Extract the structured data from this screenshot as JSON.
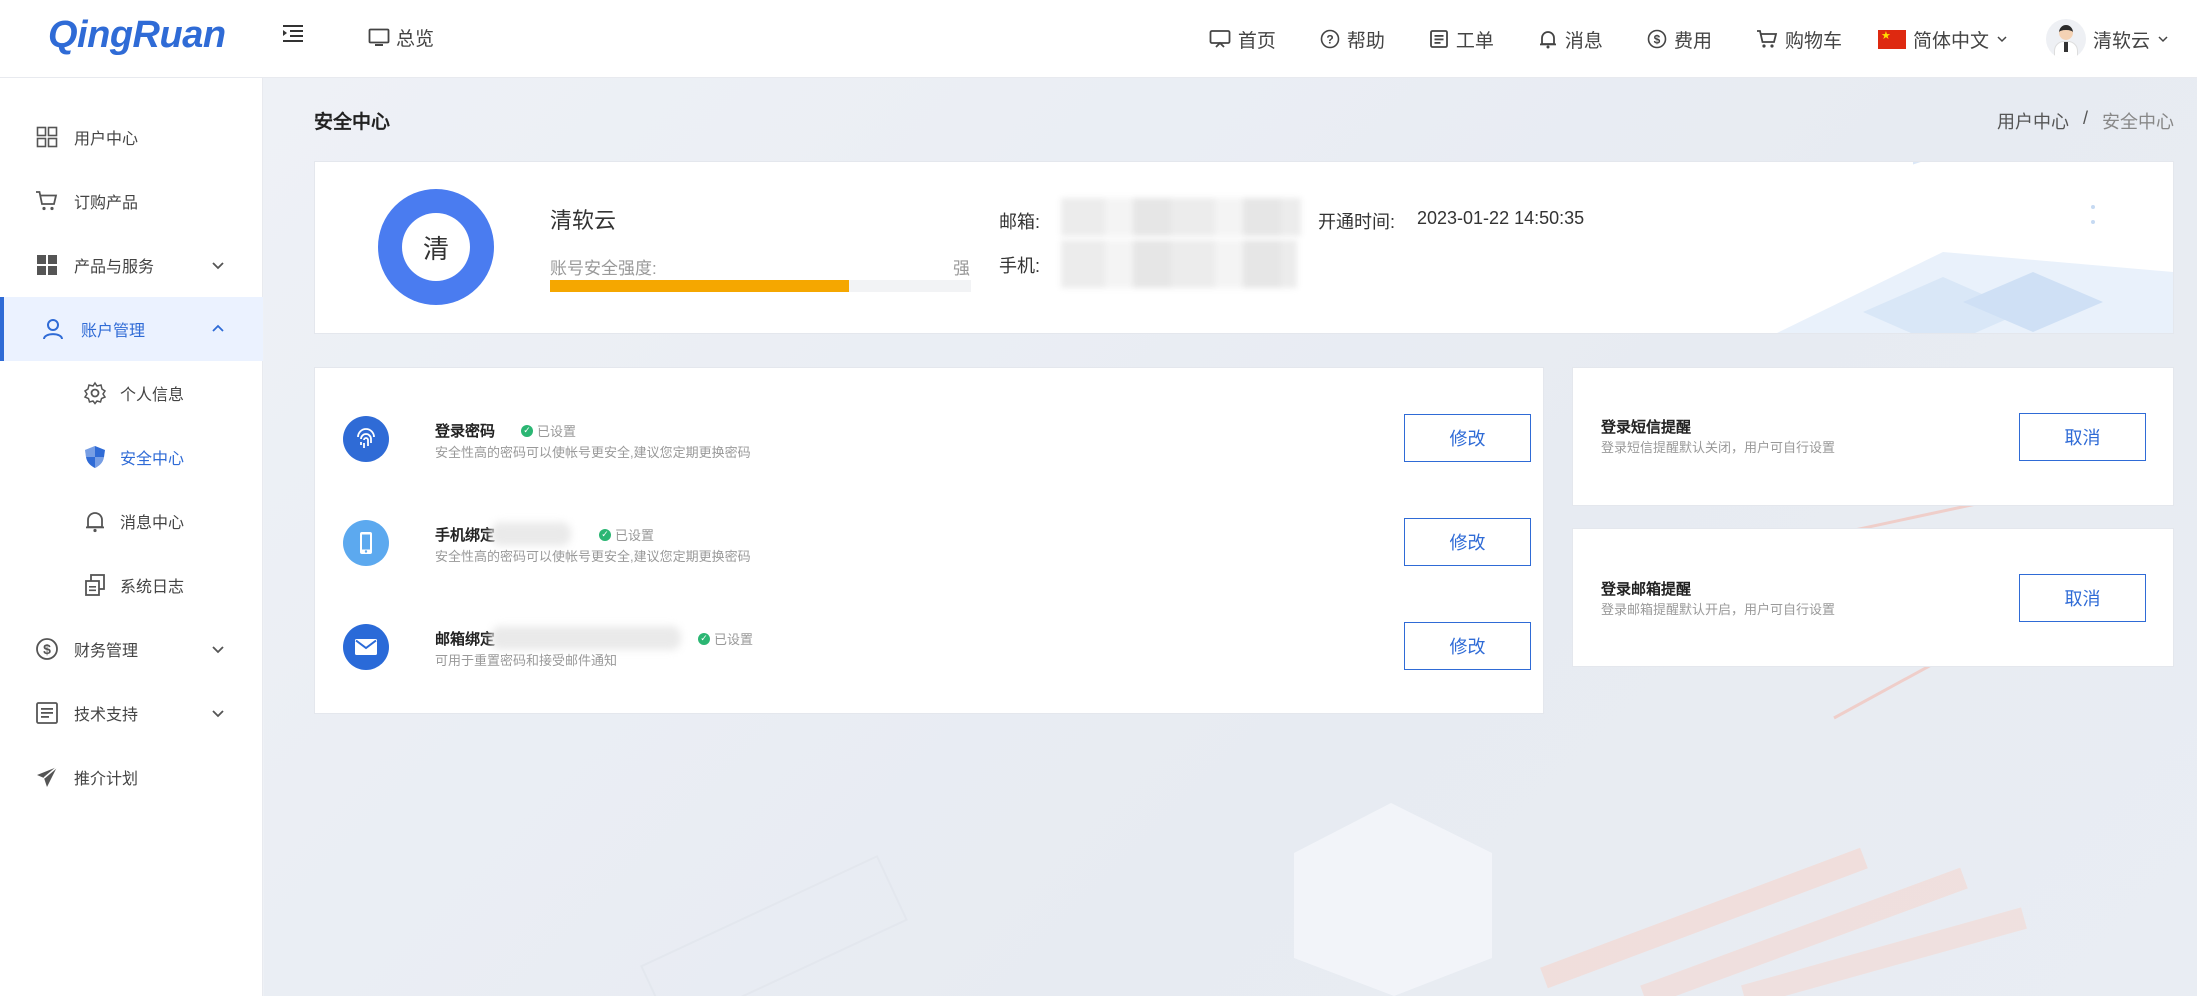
{
  "header": {
    "logo": "QingRuan",
    "overview_label": "总览",
    "nav": [
      {
        "label": "首页",
        "icon": "home-icon"
      },
      {
        "label": "帮助",
        "icon": "help-icon"
      },
      {
        "label": "工单",
        "icon": "ticket-icon"
      },
      {
        "label": "消息",
        "icon": "bell-icon"
      },
      {
        "label": "费用",
        "icon": "dollar-icon"
      },
      {
        "label": "购物车",
        "icon": "cart-icon"
      }
    ],
    "language": "简体中文",
    "username": "清软云"
  },
  "sidebar": {
    "items": [
      {
        "label": "用户中心",
        "icon": "grid-icon"
      },
      {
        "label": "订购产品",
        "icon": "cart-icon"
      },
      {
        "label": "产品与服务",
        "icon": "apps-icon"
      },
      {
        "label": "账户管理",
        "icon": "user-icon"
      },
      {
        "label": "财务管理",
        "icon": "dollar-icon"
      },
      {
        "label": "技术支持",
        "icon": "document-icon"
      },
      {
        "label": "推介计划",
        "icon": "paper-plane-icon"
      }
    ],
    "sub_items": [
      {
        "label": "个人信息",
        "icon": "gear-icon"
      },
      {
        "label": "安全中心",
        "icon": "shield-icon"
      },
      {
        "label": "消息中心",
        "icon": "bell-icon"
      },
      {
        "label": "系统日志",
        "icon": "log-icon"
      }
    ]
  },
  "page": {
    "title": "安全中心",
    "breadcrumb": [
      "用户中心",
      "/",
      "安全中心"
    ]
  },
  "profile": {
    "avatar_char": "清",
    "name": "清软云",
    "strength_label": "账号安全强度:",
    "strength_level": "强",
    "strength_fraction": 0.71,
    "email_label": "邮箱:",
    "phone_label": "手机:",
    "open_time_label": "开通时间:",
    "open_time_value": "2023-01-22 14:50:35"
  },
  "security": [
    {
      "title": "登录密码",
      "status": "已设置",
      "desc": "安全性高的密码可以使帐号更安全,建议您定期更换密码",
      "button": "修改",
      "icon": "fingerprint-icon"
    },
    {
      "title": "手机绑定",
      "status": "已设置",
      "desc": "安全性高的密码可以使帐号更安全,建议您定期更换密码",
      "button": "修改",
      "icon": "phone-icon"
    },
    {
      "title": "邮箱绑定",
      "status": "已设置",
      "desc": "可用于重置密码和接受邮件通知",
      "button": "修改",
      "icon": "mail-icon"
    }
  ],
  "notifications": [
    {
      "title": "登录短信提醒",
      "desc": "登录短信提醒默认关闭，用户可自行设置",
      "button": "取消"
    },
    {
      "title": "登录邮箱提醒",
      "desc": "登录邮箱提醒默认开启，用户可自行设置",
      "button": "取消"
    }
  ],
  "colors": {
    "accent": "#2f6bd6",
    "progress": "#f5a700",
    "success": "#2bb673"
  }
}
